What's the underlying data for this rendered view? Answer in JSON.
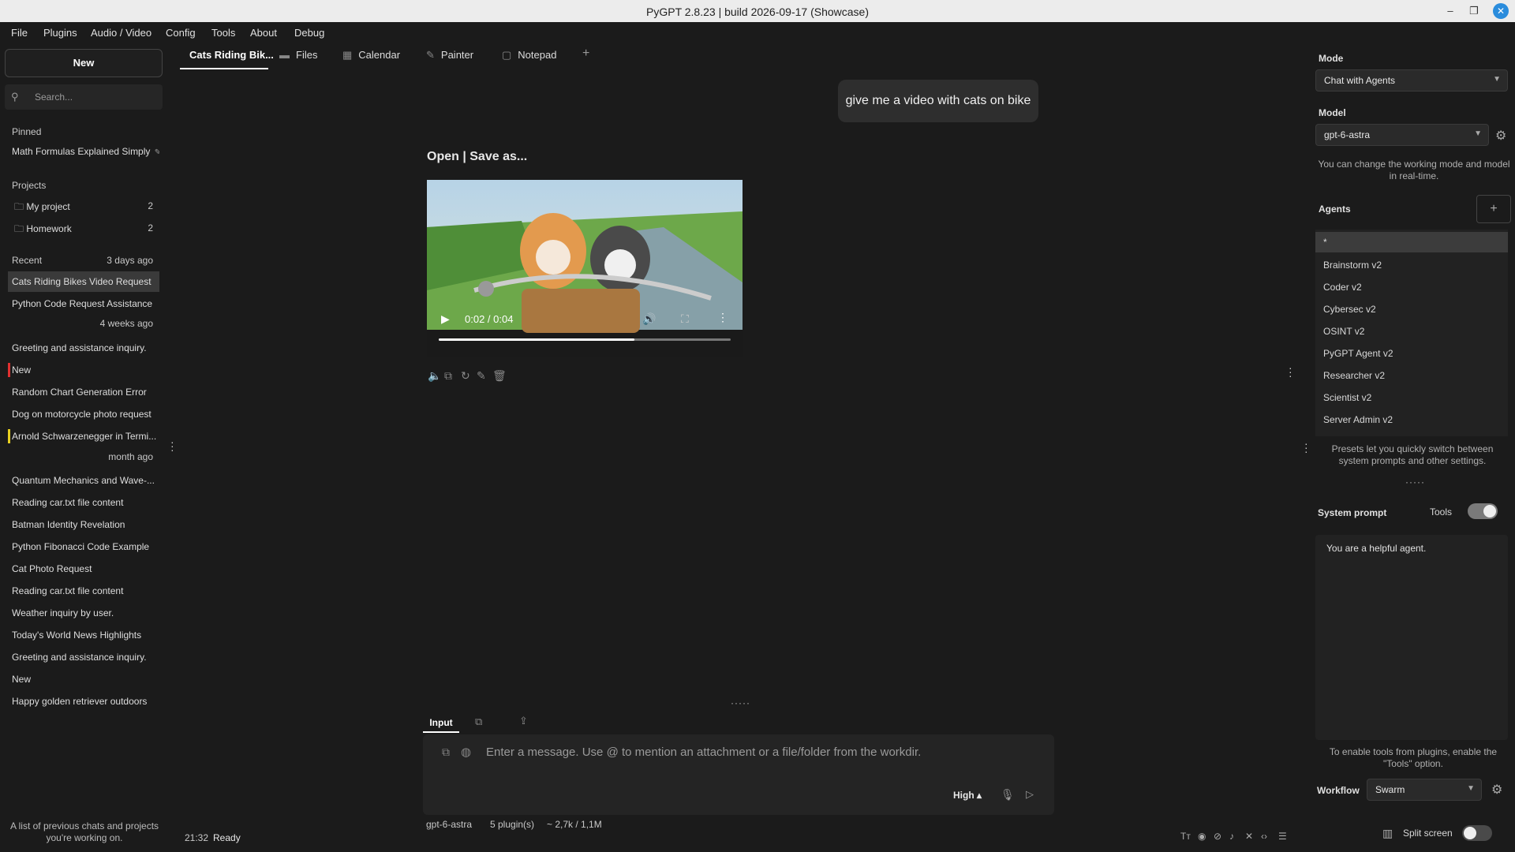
{
  "window": {
    "title": "PyGPT 2.8.23 | build 2026-09-17 (Showcase)"
  },
  "menu": [
    "File",
    "Plugins",
    "Audio / Video",
    "Config",
    "Tools",
    "About",
    "Debug"
  ],
  "sidebar": {
    "new_button": "New",
    "search_placeholder": "Search...",
    "pinned_header": "Pinned",
    "pinned": [
      {
        "label": "Math Formulas Explained Simply"
      }
    ],
    "projects_header": "Projects",
    "projects": [
      {
        "label": "My project",
        "count": "2"
      },
      {
        "label": "Homework",
        "count": "2"
      }
    ],
    "recent_header": "Recent",
    "recent_date": "3 days ago",
    "recent_selected": "Cats Riding Bikes Video Request",
    "recent_item_2": "Python Code Request Assistance",
    "date_4_weeks": "4 weeks ago",
    "weeks_items": [
      "Greeting and assistance inquiry.",
      "New",
      "Random Chart Generation Error",
      "Dog on motorcycle photo request",
      "Arnold Schwarzenegger in Termi..."
    ],
    "date_month": "month ago",
    "month_items": [
      "Quantum Mechanics and Wave-...",
      "Reading car.txt file content",
      "Batman Identity Revelation",
      "Python Fibonacci Code Example",
      "Cat Photo Request",
      "Reading car.txt file content",
      "Weather inquiry by user.",
      "Today's World News Highlights",
      "Greeting and assistance inquiry.",
      "New",
      "Happy golden retriever outdoors"
    ],
    "footer": "A list of previous chats and projects you're working on.",
    "marker_colors": {
      "new": "#e03030",
      "arnold": "#e8d020"
    }
  },
  "tabs": [
    "Cats Riding Bik...",
    "Files",
    "Calendar",
    "Painter",
    "Notepad"
  ],
  "chat": {
    "user_message": "give me a video with cats on bike",
    "links": "Open | Save as...",
    "video_time": "0:02 / 0:04",
    "video_progress": 0.67
  },
  "input": {
    "tab_label": "Input",
    "placeholder": "Enter a message. Use @ to mention an attachment or a file/folder from the workdir.",
    "level": "High ▴"
  },
  "statusbar": {
    "model": "gpt-6-astra",
    "plugins": "5 plugin(s)",
    "tokens": "~ 2,7k / 1,1M",
    "time": "21:32",
    "state": "Ready"
  },
  "right": {
    "mode_label": "Mode",
    "mode_value": "Chat with Agents",
    "model_label": "Model",
    "model_value": "gpt-6-astra",
    "model_hint": "You can change the working mode and model in real-time.",
    "agents_label": "Agents",
    "agents": [
      "*",
      "Brainstorm v2",
      "Coder v2",
      "Cybersec v2",
      "OSINT v2",
      "PyGPT Agent v2",
      "Researcher v2",
      "Scientist v2",
      "Server Admin v2"
    ],
    "presets_hint": "Presets let you quickly switch between system prompts and other settings.",
    "system_prompt_label": "System prompt",
    "tools_label": "Tools",
    "system_prompt_text": "You are a helpful agent.",
    "tools_hint": "To enable tools from plugins, enable the \"Tools\" option.",
    "workflow_label": "Workflow",
    "workflow_value": "Swarm",
    "split_label": "Split screen"
  }
}
